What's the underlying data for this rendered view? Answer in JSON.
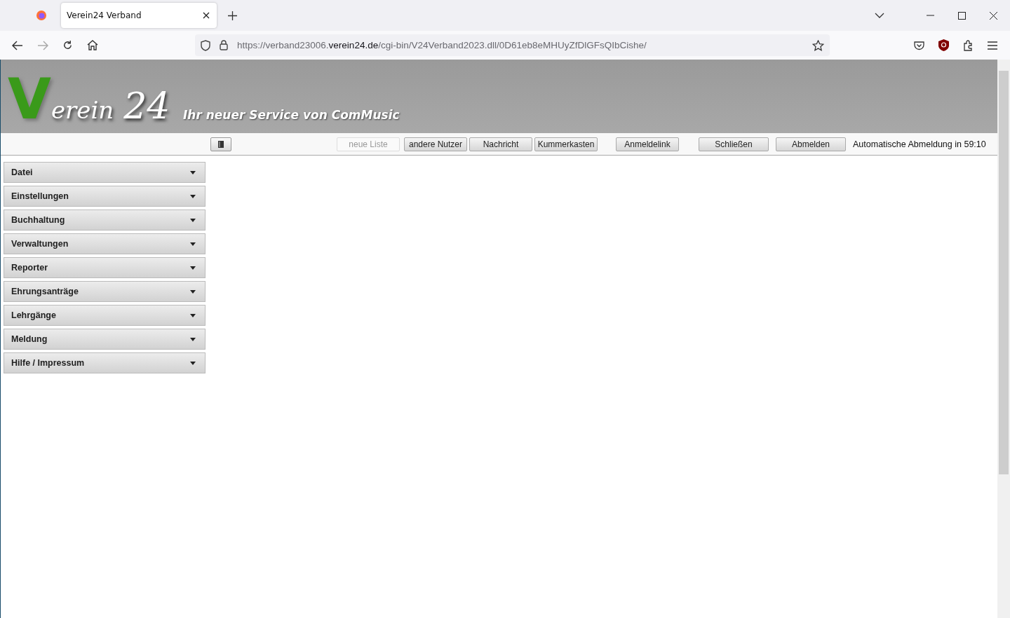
{
  "browser": {
    "tab_title": "Verein24 Verband",
    "url_host_prefix": "https://verband23006.",
    "url_host": "verein24.de",
    "url_path": "/cgi-bin/V24Verband2023.dll/0D61eb8eMHUyZfDlGFsQIbCishe/"
  },
  "header": {
    "logo_initial": "V",
    "logo_word": "erein",
    "logo_number": "24",
    "slogan": "Ihr neuer Service von ComMusic"
  },
  "toolbar": {
    "buttons": [
      {
        "label": "neue Liste",
        "disabled": true
      },
      {
        "label": "andere Nutzer",
        "disabled": false
      },
      {
        "label": "Nachricht",
        "disabled": false
      },
      {
        "label": "Kummerkasten",
        "disabled": false
      },
      {
        "label": "Anmeldelink",
        "disabled": false
      },
      {
        "label": "Schließen",
        "disabled": false
      },
      {
        "label": "Abmelden",
        "disabled": false
      }
    ],
    "logout_timer": "Automatische Abmeldung in 59:10"
  },
  "menu": [
    {
      "label": "Datei",
      "expanded": false
    },
    {
      "label": "Einstellungen",
      "expanded": false
    },
    {
      "label": "Buchhaltung",
      "expanded": false
    },
    {
      "label": "Verwaltungen",
      "expanded": false
    },
    {
      "label": "Reporter",
      "expanded": false
    },
    {
      "label": "Ehrungsanträge",
      "expanded": false
    },
    {
      "label": "Lehrgänge",
      "expanded": false
    },
    {
      "label": "Meldung",
      "expanded": false
    },
    {
      "label": "Hilfe / Impressum",
      "expanded": false
    }
  ]
}
